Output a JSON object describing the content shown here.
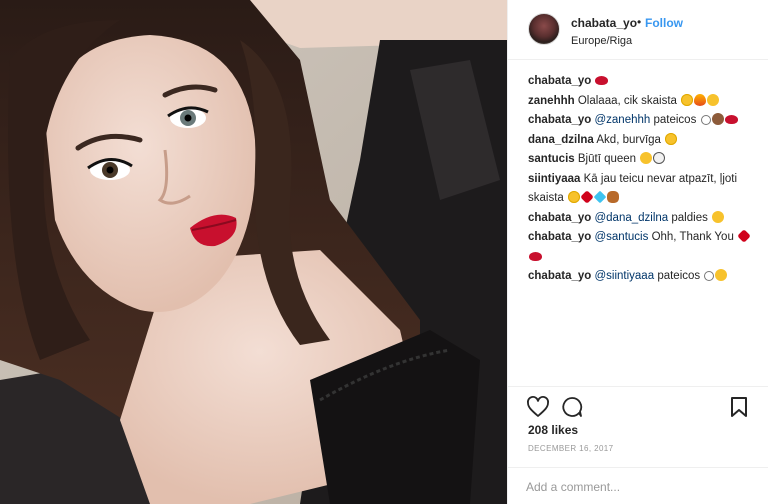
{
  "post": {
    "username": "chabata_yo",
    "separator": "•",
    "follow_label": "Follow",
    "location": "Europe/Riga",
    "likes": "208 likes",
    "date": "December 16, 2017",
    "add_comment_placeholder": "Add a comment..."
  },
  "comments": [
    {
      "user": "chabata_yo",
      "mention": "",
      "text": "",
      "emojis": [
        "lips"
      ]
    },
    {
      "user": "zanehhh",
      "mention": "",
      "text": "Olalaaa, cik skaista",
      "emojis": [
        "heart-eyes",
        "fire",
        "smile"
      ]
    },
    {
      "user": "chabata_yo",
      "mention": "@zanehhh",
      "text": "pateicos",
      "emojis": [
        "halo",
        "monkey",
        "lips"
      ]
    },
    {
      "user": "dana_dzilna",
      "mention": "",
      "text": "Akd, burvīga",
      "emojis": [
        "heart-eyes"
      ]
    },
    {
      "user": "santucis",
      "mention": "",
      "text": "Bjūtī queen",
      "emojis": [
        "wink",
        "ghost"
      ]
    },
    {
      "user": "siintiyaaa",
      "mention": "",
      "text": "Kā jau teicu nevar atpazīt, ļjoti skaista",
      "emojis": [
        "heart-eyes",
        "heart",
        "diamond",
        "butterfly"
      ]
    },
    {
      "user": "chabata_yo",
      "mention": "@dana_dzilna",
      "text": "paldies",
      "emojis": [
        "smile"
      ]
    },
    {
      "user": "chabata_yo",
      "mention": "@santucis",
      "text": "Ohh, Thank You",
      "emojis": [
        "heart",
        "lips"
      ]
    },
    {
      "user": "chabata_yo",
      "mention": "@siintiyaaa",
      "text": "pateicos",
      "emojis": [
        "halo",
        "wink"
      ]
    }
  ],
  "icons": {
    "like": "heart-outline-icon",
    "comment": "speech-bubble-icon",
    "save": "bookmark-icon"
  },
  "colors": {
    "follow": "#3897f0",
    "text": "#262626",
    "muted": "#999999",
    "lipstick": "#c8102e"
  }
}
